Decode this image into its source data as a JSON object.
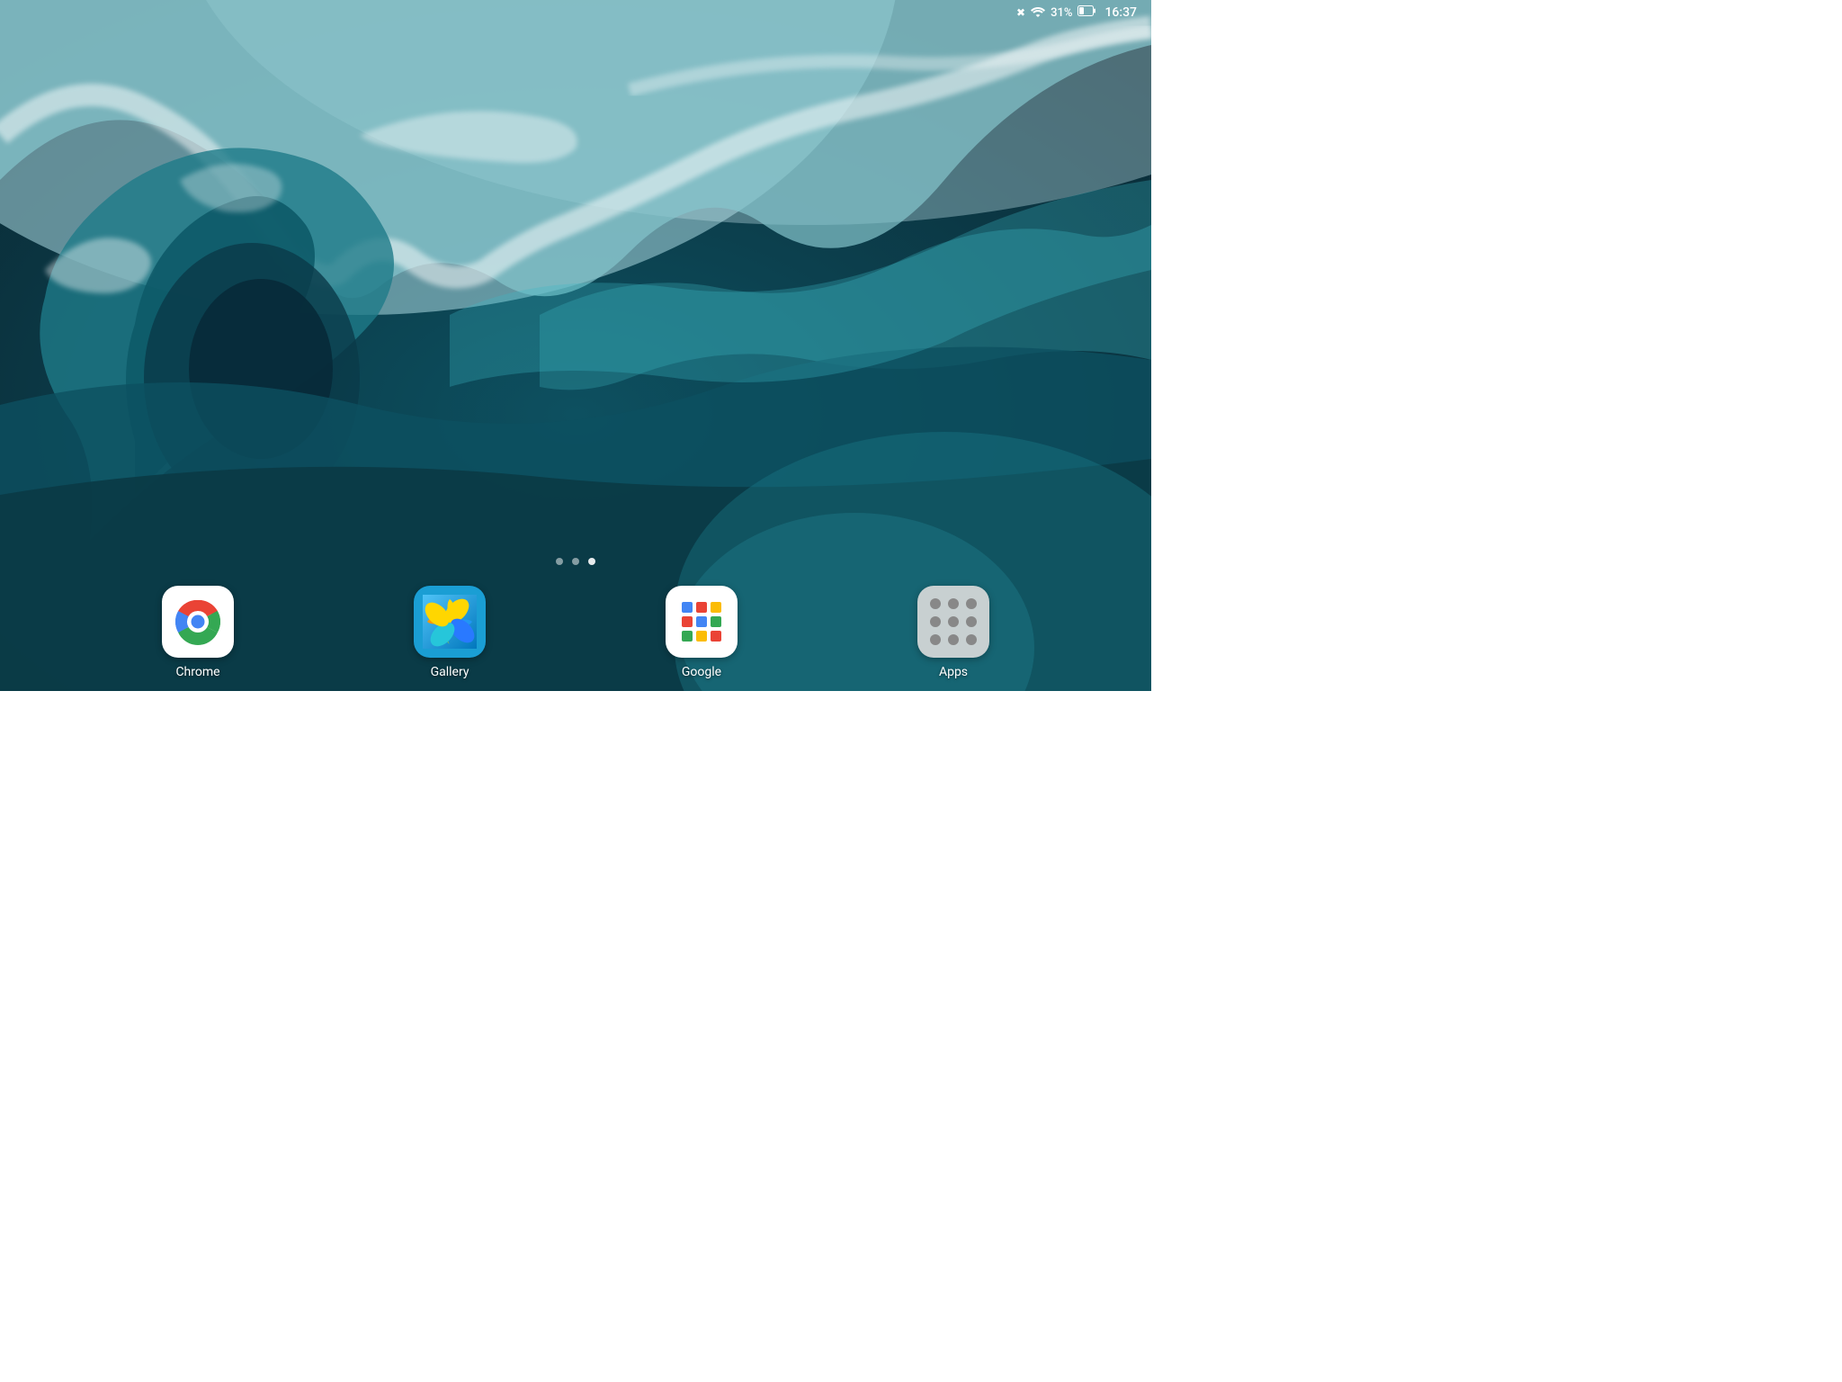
{
  "status_bar": {
    "bluetooth_icon": "bluetooth",
    "wifi_icon": "wifi",
    "battery_percent": "31%",
    "battery_icon": "battery",
    "time": "16:37"
  },
  "page_indicators": [
    {
      "id": "dot1",
      "active": false
    },
    {
      "id": "dot2",
      "active": false
    },
    {
      "id": "dot3",
      "active": true
    }
  ],
  "dock": {
    "apps": [
      {
        "id": "chrome",
        "label": "Chrome",
        "icon_type": "chrome"
      },
      {
        "id": "gallery",
        "label": "Gallery",
        "icon_type": "gallery"
      },
      {
        "id": "google",
        "label": "Google",
        "icon_type": "google"
      },
      {
        "id": "apps",
        "label": "Apps",
        "icon_type": "apps"
      }
    ]
  }
}
